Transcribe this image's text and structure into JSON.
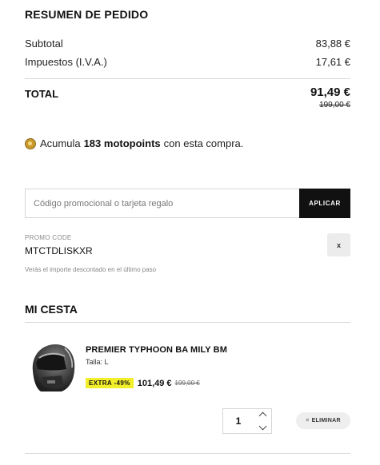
{
  "summary": {
    "title": "RESUMEN DE PEDIDO",
    "subtotal_label": "Subtotal",
    "subtotal_value": "83,88 €",
    "tax_label": "Impuestos (I.V.A.)",
    "tax_value": "17,61 €",
    "total_label": "TOTAL",
    "total_value": "91,49 €",
    "total_old": "199,00 €"
  },
  "points": {
    "icon": "motopoints-coin-icon",
    "prefix": "Acumula",
    "highlight": "183 motopoints",
    "suffix": "con esta compra."
  },
  "promo": {
    "placeholder": "Código promocional o tarjeta regalo",
    "apply_label": "APLICAR",
    "code_label": "PROMO CODE",
    "code_value": "MTCTDLISKXR",
    "remove_label": "x",
    "note": "Verás el importe descontado en el último paso"
  },
  "cart": {
    "title": "MI CESTA",
    "items": [
      {
        "name": "PREMIER TYPHOON BA MILY BM",
        "size": "Talla: L",
        "badge": "EXTRA -49%",
        "price": "101,49 €",
        "old_price": "199,00 €",
        "quantity": "1",
        "remove_label": "ELIMINAR",
        "remove_icon": "×"
      }
    ]
  },
  "colors": {
    "accent_button": "#111111",
    "badge": "#f2ee2a"
  }
}
